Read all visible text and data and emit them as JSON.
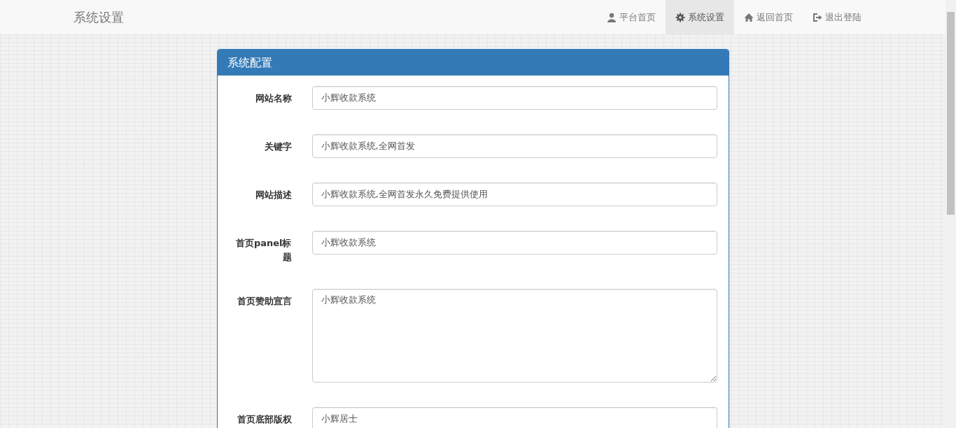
{
  "navbar": {
    "brand": "系统设置",
    "items": [
      {
        "kind": "user",
        "label": "平台首页",
        "selected": false
      },
      {
        "kind": "gear",
        "label": "系统设置",
        "selected": true
      },
      {
        "kind": "home",
        "label": "返回首页",
        "selected": false
      },
      {
        "kind": "logout",
        "label": "退出登陆",
        "selected": false
      }
    ]
  },
  "panel": {
    "title": "系统配置",
    "fields": [
      {
        "kind": "input",
        "label": "网站名称",
        "value": "小辉收款系统"
      },
      {
        "kind": "input",
        "label": "关键字",
        "value": "小辉收款系统,全网首发"
      },
      {
        "kind": "input",
        "label": "网站描述",
        "value": "小辉收款系统,全网首发永久免费提供使用"
      },
      {
        "kind": "input",
        "label": "首页panel标题",
        "value": "小辉收款系统"
      },
      {
        "kind": "textarea",
        "label": "首页赞助宣言",
        "value": "小辉收款系统"
      },
      {
        "kind": "input",
        "label": "首页底部版权",
        "value": "小辉居士"
      }
    ]
  }
}
